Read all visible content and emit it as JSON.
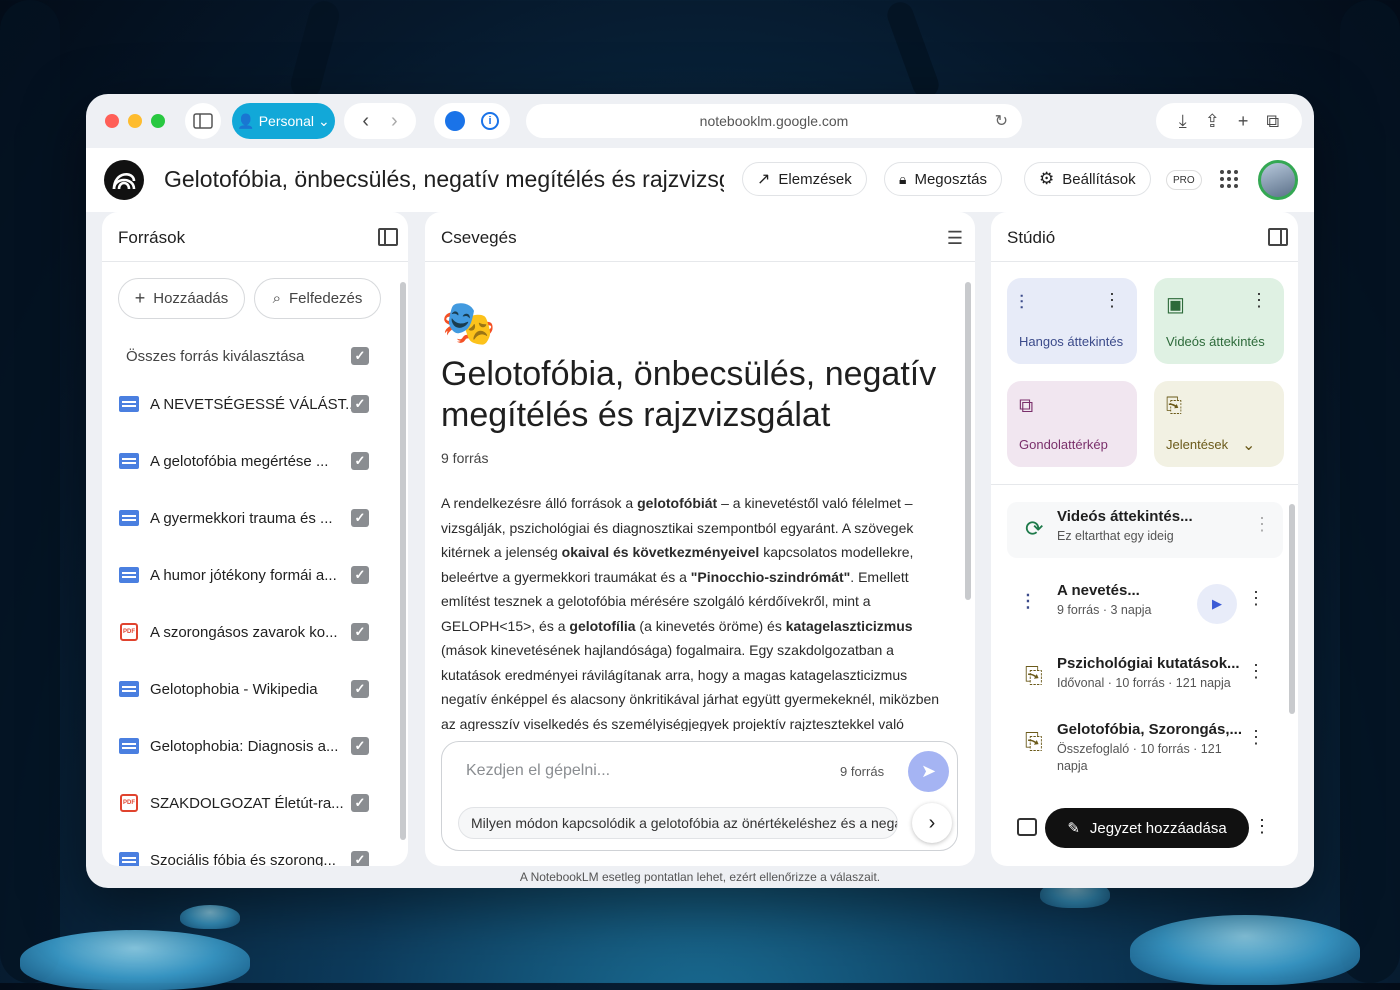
{
  "browser": {
    "profile_label": "Personal",
    "url": "notebooklm.google.com"
  },
  "header": {
    "notebook_title": "Gelotofóbia, önbecsülés, negatív megítélés és rajzvizsgálat",
    "analytics_label": "Elemzések",
    "share_label": "Megosztás",
    "settings_label": "Beállítások",
    "pro_badge": "PRO"
  },
  "sources": {
    "title": "Források",
    "add_label": "Hozzáadás",
    "discover_label": "Felfedezés",
    "select_all_label": "Összes forrás kiválasztása",
    "items": [
      {
        "label": "A NEVETSÉGESSÉ VÁLÁST...",
        "type": "doc"
      },
      {
        "label": "A gelotofóbia megértése ...",
        "type": "doc"
      },
      {
        "label": "A gyermekkori trauma és ...",
        "type": "doc"
      },
      {
        "label": "A humor jótékony formái a...",
        "type": "doc"
      },
      {
        "label": "A szorongásos zavarok ko...",
        "type": "pdf"
      },
      {
        "label": "Gelotophobia - Wikipedia",
        "type": "doc"
      },
      {
        "label": "Gelotophobia: Diagnosis a...",
        "type": "doc"
      },
      {
        "label": "SZAKDOLGOZAT Életút-ra...",
        "type": "pdf"
      },
      {
        "label": "Szociális fóbia és szorong...",
        "type": "doc"
      }
    ]
  },
  "chat": {
    "title": "Csevegés",
    "emoji": "🎭",
    "notebook_heading": "Gelotofóbia, önbecsülés, negatív megítélés és rajzvizsgálat",
    "source_count": "9 forrás",
    "summary_parts": [
      {
        "t": "A rendelkezésre álló források a ",
        "b": false
      },
      {
        "t": "gelotofóbiát",
        "b": true
      },
      {
        "t": " – a kinevetéstől való félelmet – vizsgálják, pszichológiai és diagnosztikai szempontból egyaránt. A szövegek kitérnek a jelenség ",
        "b": false
      },
      {
        "t": "okaival és következményeivel",
        "b": true
      },
      {
        "t": " kapcsolatos modellekre, beleértve a gyermekkori traumákat és a ",
        "b": false
      },
      {
        "t": "\"Pinocchio-szindrómát\"",
        "b": true
      },
      {
        "t": ". Emellett említést tesznek a gelotofóbia mérésére szolgáló kérdőívekről, mint a GELOPH<15>, és a ",
        "b": false
      },
      {
        "t": "gelotofília",
        "b": true
      },
      {
        "t": " (a kinevetés öröme) és ",
        "b": false
      },
      {
        "t": "katagelaszticizmus",
        "b": true
      },
      {
        "t": " (mások kinevetésének hajlandósága) fogalmaira. Egy szakdolgozatban a kutatások eredményei rávilágítanak arra, hogy a magas katagelaszticizmus negatív énképpel és alacsony önkritikával járhat együtt gyermekeknél, miközben az agresszív viselkedés és személyiségjegyek projektív rajztesztekkel való vizsgálatának lehetőségeit is feltárják. Az eLitMed.hu oldalon",
        "b": false
      }
    ],
    "input_placeholder": "Kezdjen el gépelni...",
    "input_source_count": "9 forrás",
    "suggestion": "Milyen módon kapcsolódik a gelotofóbia az önértékeléshez és a negatív megítéléshez?",
    "disclaimer": "A NotebookLM esetleg pontatlan lehet, ezért ellenőrizze a válaszait."
  },
  "studio": {
    "title": "Stúdió",
    "cards": [
      {
        "label": "Hangos áttekintés",
        "icon": "audio-wave-icon",
        "color": "#e7ebf8",
        "text_color": "#3b4a8a"
      },
      {
        "label": "Videós áttekintés",
        "icon": "video-icon",
        "color": "#dff1e3",
        "text_color": "#2d6a3a"
      },
      {
        "label": "Gondolattérkép",
        "icon": "mindmap-icon",
        "color": "#f1e6f0",
        "text_color": "#7a2f6b"
      },
      {
        "label": "Jelentések",
        "icon": "report-icon",
        "color": "#f2f1e3",
        "text_color": "#6b5a1a"
      }
    ],
    "outputs": [
      {
        "title": "Videós áttekintés...",
        "sub": "Ez eltarthat egy ideig",
        "icon": "sync-icon"
      },
      {
        "title": "A nevetés...",
        "sub": "9 forrás · 3 napja",
        "icon": "audio-wave-icon"
      },
      {
        "title": "Pszichológiai kutatások...",
        "sub": "Idővonal · 10 forrás · 121 napja",
        "icon": "report-icon"
      },
      {
        "title": "Gelotofóbia, Szorongás,...",
        "sub": "Összefoglaló · 10 forrás · 121 napja",
        "icon": "report-icon"
      }
    ],
    "add_note_label": "Jegyzet hozzáadása"
  }
}
